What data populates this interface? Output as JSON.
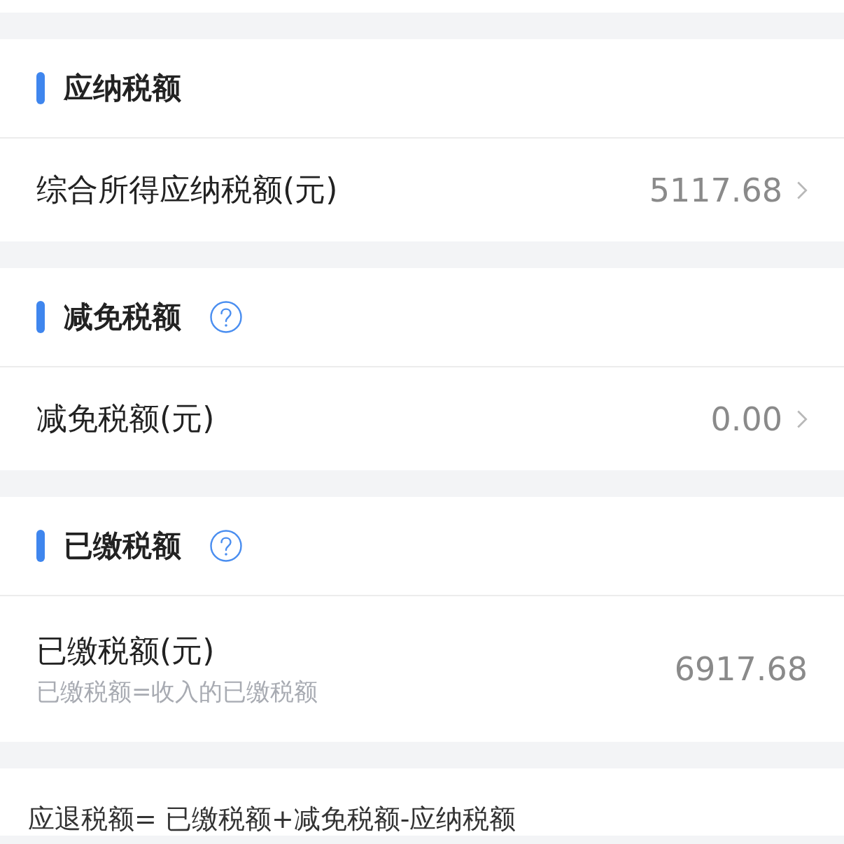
{
  "sections": [
    {
      "title": "应纳税额",
      "help": false,
      "row": {
        "label": "综合所得应纳税额(元)",
        "value": "5117.68",
        "chevron": true
      }
    },
    {
      "title": "减免税额",
      "help": true,
      "row": {
        "label": "减免税额(元)",
        "value": "0.00",
        "chevron": true
      }
    },
    {
      "title": "已缴税额",
      "help": true,
      "row": {
        "label": "已缴税额(元)",
        "sublabel": "已缴税额=收入的已缴税额",
        "value": "6917.68",
        "chevron": false
      }
    }
  ],
  "formula": "应退税额= 已缴税额+减免税额-应纳税额"
}
